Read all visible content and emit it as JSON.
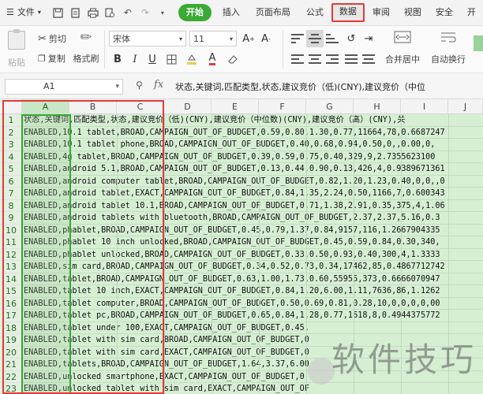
{
  "menu": {
    "file": "文件",
    "items": [
      "开始",
      "插入",
      "页面布局",
      "公式",
      "数据",
      "审阅",
      "视图",
      "安全",
      "开"
    ]
  },
  "ribbon": {
    "paste": "粘贴",
    "cut": "剪切",
    "copy": "复制",
    "format_painter": "格式刷",
    "font_name": "宋体",
    "font_size": "11",
    "merge_center": "合并居中",
    "auto_wrap": "自动换行"
  },
  "formula_bar": {
    "name_box": "A1",
    "fx": "fx",
    "content": "状态,关键词,匹配类型,状态,建议竞价（低)(CNY),建议竞价（中位"
  },
  "columns": [
    "A",
    "B",
    "C",
    "D",
    "E",
    "F",
    "G",
    "H",
    "I",
    "J"
  ],
  "rows": [
    {
      "num": "1",
      "text": "状态,关键词,匹配类型,状态,建议竞价（低)(CNY),建议竞价（中位数)(CNY),建议竞价（高）(CNY),关"
    },
    {
      "num": "2",
      "text": "ENABLED,10.1 tablet,BROAD,CAMPAIGN_OUT_OF_BUDGET,0.59,0.80,1.30,0.77,11664,78,0.6687247"
    },
    {
      "num": "3",
      "text": "ENABLED,10.1 tablet phone,BROAD,CAMPAIGN_OUT_OF_BUDGET,0.40,0.68,0.94,0.50,0,,0.00,0,"
    },
    {
      "num": "4",
      "text": "ENABLED,4g tablet,BROAD,CAMPAIGN_OUT_OF_BUDGET,0.39,0.59,0.75,0.40,329,9,2.7355623100"
    },
    {
      "num": "5",
      "text": "ENABLED,android 5.1,BROAD,CAMPAIGN_OUT_OF_BUDGET,0.13,0.44,0.90,0.13,426,4,0.9389671361"
    },
    {
      "num": "6",
      "text": "ENABLED,android computer tablet,BROAD,CAMPAIGN_OUT_OF_BUDGET,0.82,1.20,1.23,0.40,0,0,,0"
    },
    {
      "num": "7",
      "text": "ENABLED,android tablet,EXACT,CAMPAIGN_OUT_OF_BUDGET,0.84,1.35,2.24,0.50,1166,7,0.600343"
    },
    {
      "num": "8",
      "text": "ENABLED,android tablet 10.1,BROAD,CAMPAIGN_OUT_OF_BUDGET,0.71,1.38,2.91,0.35,375,4,1.06"
    },
    {
      "num": "9",
      "text": "ENABLED,android tablets with bluetooth,BROAD,CAMPAIGN_OUT_OF_BUDGET,2.37,2.37,5.16,0.3"
    },
    {
      "num": "10",
      "text": "ENABLED,phablet,BROAD,CAMPAIGN_OUT_OF_BUDGET,0.45,0.79,1.37,0.84,9157,116,1.2667904335"
    },
    {
      "num": "11",
      "text": "ENABLED,phablet 10 inch unlocked,BROAD,CAMPAIGN_OUT_OF_BUDGET,0.45,0.59,0.84,0.30,340,"
    },
    {
      "num": "12",
      "text": "ENABLED,phablet unlocked,BROAD,CAMPAIGN_OUT_OF_BUDGET,0.33,0.50,0.93,0.40,300,4,1.3333"
    },
    {
      "num": "13",
      "text": "ENABLED,sim card,BROAD,CAMPAIGN_OUT_OF_BUDGET,0.34,0.52,0.73,0.34,17462,85,0.4867712742"
    },
    {
      "num": "14",
      "text": "ENABLED,tablet,BROAD,CAMPAIGN_OUT_OF_BUDGET,0.63,1.00,1.73,0.60,55955,373,0.6666070947"
    },
    {
      "num": "15",
      "text": "ENABLED,tablet 10 inch,EXACT,CAMPAIGN_OUT_OF_BUDGET,0.84,1.20,6.00,1.11,7636,86,1.1262"
    },
    {
      "num": "16",
      "text": "ENABLED,tablet computer,BROAD,CAMPAIGN_OUT_OF_BUDGET,0.50,0.69,0.81,0.28,10,0,0,0,0,00"
    },
    {
      "num": "17",
      "text": "ENABLED,tablet pc,BROAD,CAMPAIGN_OUT_OF_BUDGET,0.65,0.84,1.28,0.77,1618,8,0.4944375772"
    },
    {
      "num": "18",
      "text": "ENABLED,tablet under 100,EXACT,CAMPAIGN_OUT_OF_BUDGET,0.45,"
    },
    {
      "num": "19",
      "text": "ENABLED,tablet with sim card,BROAD,CAMPAIGN_OUT_OF_BUDGET,0"
    },
    {
      "num": "20",
      "text": "ENABLED,tablet with sim card,EXACT,CAMPAIGN_OUT_OF_BUDGET,0"
    },
    {
      "num": "21",
      "text": "ENABLED,tablets,BROAD,CAMPAIGN_OUT_OF_BUDGET,1.64,3.37,6.00"
    },
    {
      "num": "22",
      "text": "ENABLED,unlocked smartphone,EXACT,CAMPAIGN_OUT_OF_BUDGET,0"
    },
    {
      "num": "23",
      "text": "ENABLED,unlocked tablet with sim card,EXACT,CAMPAIGN_OUT_OF"
    }
  ],
  "watermark": "软件技巧",
  "colors": {
    "start_green": "#3aaa35",
    "highlight_red": "#e23a3a",
    "selection_green": "#d6efd3"
  }
}
